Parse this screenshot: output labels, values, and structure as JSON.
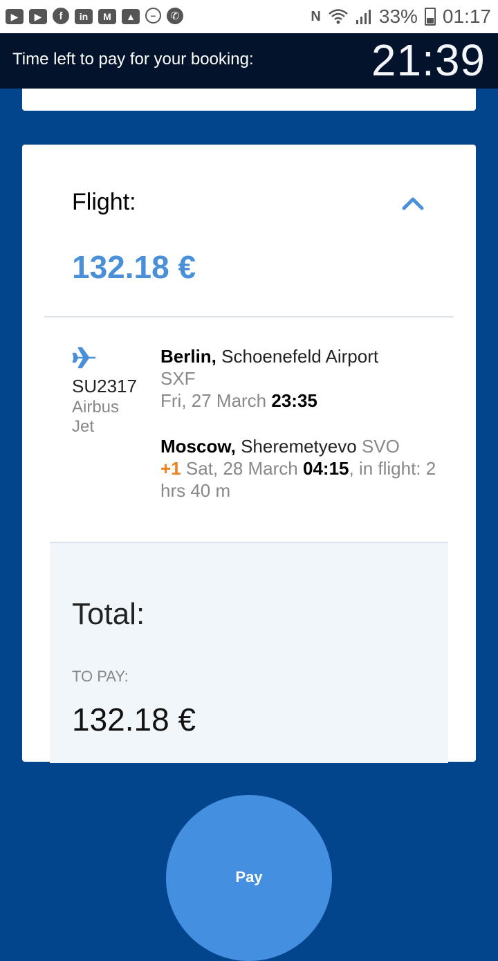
{
  "status_bar": {
    "icons": [
      "youtube-icon",
      "youtube-icon",
      "facebook-icon",
      "linkedin-icon",
      "gmail-icon",
      "gallery-icon",
      "do-not-disturb-icon",
      "phone-icon"
    ],
    "battery": "33%",
    "time": "01:17"
  },
  "timer": {
    "label": "Time left to pay for your booking:",
    "value": "21:39"
  },
  "flight": {
    "title": "Flight:",
    "price": "132.18 €",
    "flight_number": "SU2317",
    "aircraft": "Airbus Jet",
    "departure": {
      "city": "Berlin,",
      "airport": "Schoenefeld Airport",
      "code": "SXF",
      "date": "Fri, 27 March",
      "time": "23:35"
    },
    "arrival": {
      "city": "Moscow,",
      "airport": "Sheremetyevo",
      "code": "SVO",
      "day_offset": "+1",
      "date": "Sat, 28 March",
      "time": "04:15",
      "duration": ", in flight: 2 hrs 40 m"
    }
  },
  "total": {
    "title": "Total:",
    "to_pay_label": "TO PAY:",
    "to_pay_value": "132.18 €"
  },
  "pay_button": {
    "label": "Pay"
  },
  "colors": {
    "background": "#03458c",
    "accent": "#4a90d9",
    "timer_bar": "#02132b",
    "day_offset": "#f07f1b"
  }
}
